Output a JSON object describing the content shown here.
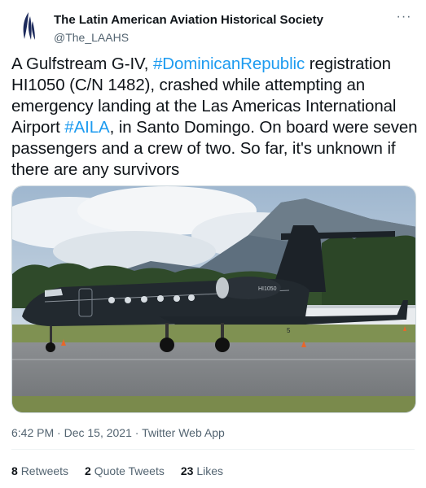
{
  "account": {
    "display_name": "The Latin American Aviation Historical Society",
    "handle": "@The_LAAHS",
    "avatar_icon": "laahs-logo-icon"
  },
  "menu": {
    "more_label": "···"
  },
  "tweet": {
    "segments": [
      {
        "text": "A Gulfstream G-IV, ",
        "link": false
      },
      {
        "text": "#DominicanRepublic",
        "link": true
      },
      {
        "text": " registration HI1050 (C/N 1482), crashed while attempting an emergency landing at the Las Americas International Airport ",
        "link": false
      },
      {
        "text": "#AILA",
        "link": true
      },
      {
        "text": ", in Santo Domingo. On board were seven passengers and a crew of two. So far, it's unknown if there are any survivors",
        "link": false
      }
    ],
    "image": {
      "registration_text": "HI1050",
      "tail_number": "5"
    },
    "time": "6:42 PM",
    "separator": " · ",
    "date": "Dec 15, 2021",
    "source": "Twitter Web App"
  },
  "stats": {
    "retweets": {
      "count": "8",
      "label": "Retweets"
    },
    "quotes": {
      "count": "2",
      "label": "Quote Tweets"
    },
    "likes": {
      "count": "23",
      "label": "Likes"
    }
  },
  "colors": {
    "link": "#1d9bf0",
    "muted": "#536471",
    "text": "#0f1419",
    "border": "#eff3f4"
  }
}
